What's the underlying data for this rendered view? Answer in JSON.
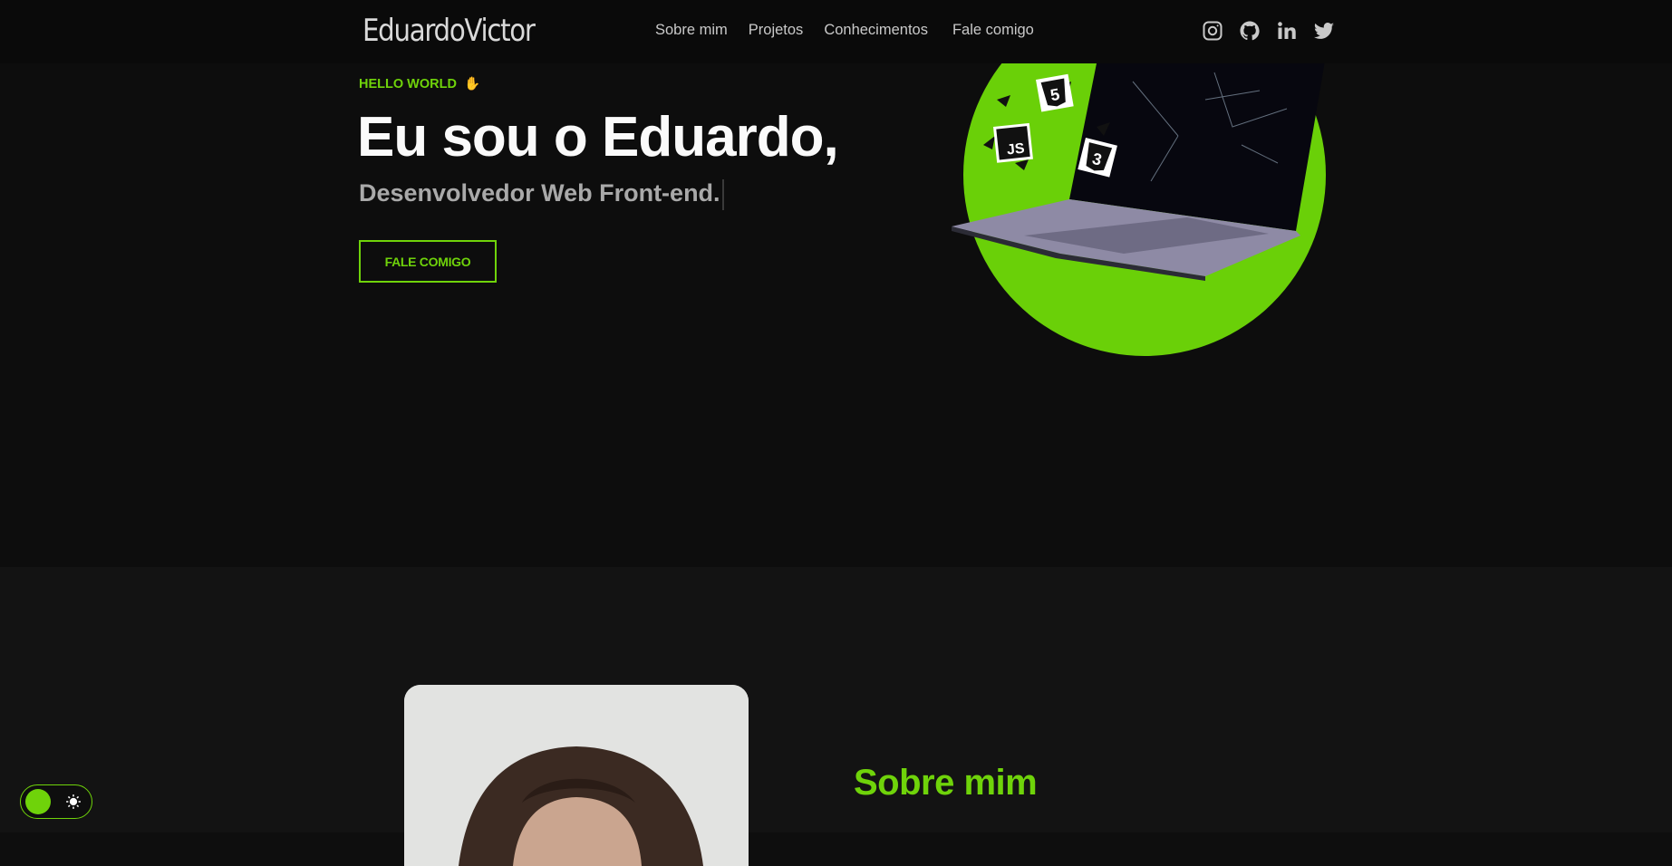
{
  "header": {
    "logo": "EduardoVictor",
    "nav": [
      "Sobre mim",
      "Projetos",
      "Conhecimentos",
      "Fale comigo"
    ],
    "socials": [
      "instagram-icon",
      "github-icon",
      "linkedin-icon",
      "twitter-icon"
    ]
  },
  "hero": {
    "eyebrow": "HELLO WORLD",
    "eyebrow_emoji": "✋",
    "title": "Eu sou o Eduardo,",
    "subtitle": "Desenvolvedor Web Front-end.",
    "cta_label": "FALE COMIGO",
    "badges": [
      "5",
      "JS",
      "3"
    ]
  },
  "about": {
    "title": "Sobre mim"
  },
  "theme_toggle": {
    "icon": "sun-icon"
  },
  "colors": {
    "accent": "#6fd30a",
    "background": "#0d0d0d",
    "header": "#0a0a0a",
    "section_alt": "#131313"
  }
}
